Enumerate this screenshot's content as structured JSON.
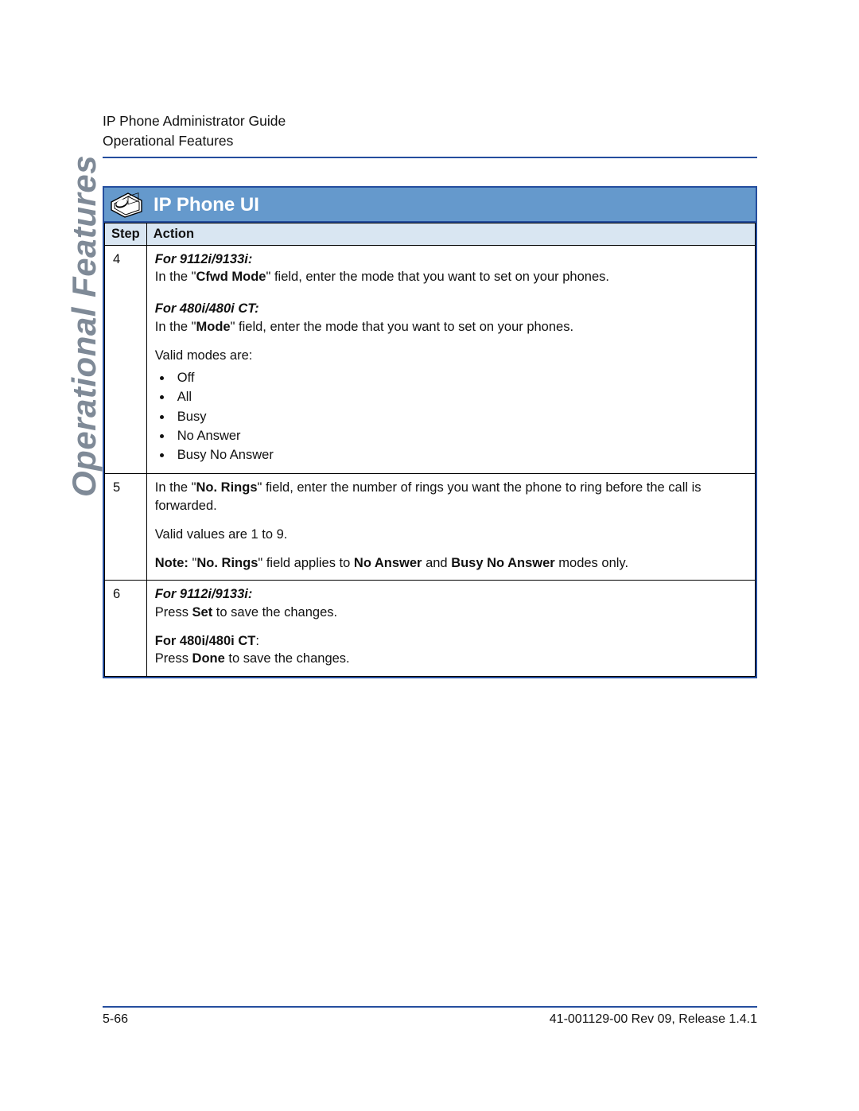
{
  "colors": {
    "accent": "#6599CC",
    "thead": "#D9E6F2",
    "rule": "#254E9E"
  },
  "header": {
    "line1": "IP Phone Administrator Guide",
    "line2": "Operational Features"
  },
  "sideLabel": "Operational Features",
  "panel": {
    "title": "IP Phone UI",
    "columns": {
      "step": "Step",
      "action": "Action"
    }
  },
  "rows": [
    {
      "step": "4",
      "blocks": [
        {
          "heading_bi": "For 9112i/9133i:",
          "line_parts": [
            "In the \"",
            "Cfwd Mode",
            "\" field, enter the mode that you want to set on your phones."
          ]
        },
        {
          "heading_bi": "For 480i/480i CT:",
          "line_parts": [
            "In the \"",
            "Mode",
            "\" field, enter the mode that you want to set on your phones."
          ]
        },
        {
          "plain": "Valid modes are:"
        },
        {
          "list": [
            "Off",
            "All",
            "Busy",
            "No Answer",
            "Busy No Answer"
          ]
        }
      ]
    },
    {
      "step": "5",
      "blocks": [
        {
          "line_parts": [
            "In the \"",
            "No. Rings",
            "\" field, enter the number of rings you want the phone to ring before the call is forwarded."
          ]
        },
        {
          "plain": "Valid values are 1 to 9."
        },
        {
          "note_parts": [
            "Note:",
            " \"",
            "No. Rings",
            "\" field applies to ",
            "No Answer",
            " and ",
            "Busy No Answer",
            " modes only."
          ]
        }
      ]
    },
    {
      "step": "6",
      "blocks": [
        {
          "heading_bi": "For 9112i/9133i:",
          "press_parts": [
            "Press ",
            "Set",
            " to save the changes."
          ]
        },
        {
          "heading_b": "For 480i/480i CT",
          "heading_suffix": ":",
          "press_parts": [
            "Press ",
            "Done",
            " to save the changes."
          ]
        }
      ]
    }
  ],
  "footer": {
    "page": "5-66",
    "docid": "41-001129-00 Rev 09, Release 1.4.1"
  }
}
